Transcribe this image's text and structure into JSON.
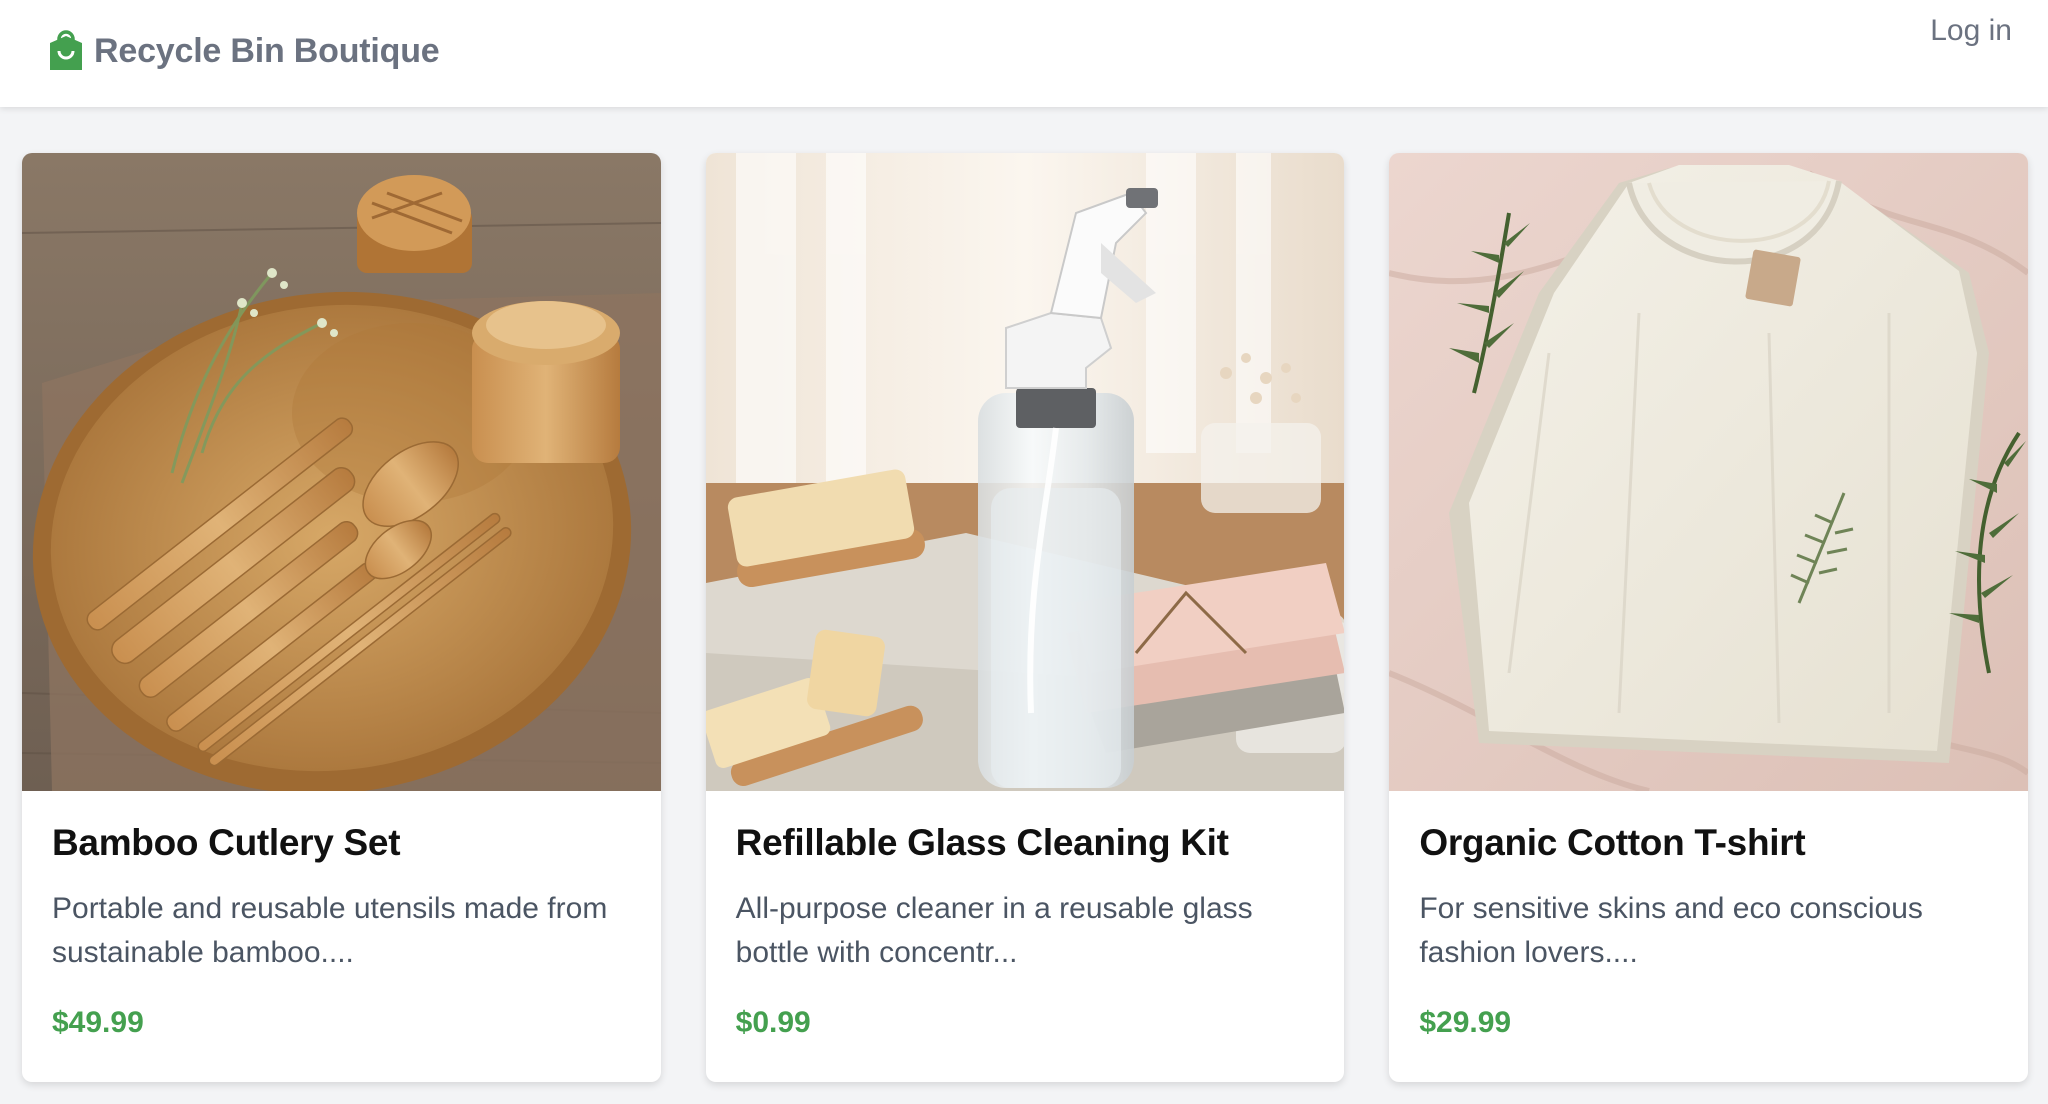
{
  "header": {
    "brand_name": "Recycle Bin Boutique",
    "brand_icon": "shopping-bag-icon",
    "login_label": "Log in"
  },
  "colors": {
    "brand_icon": "#44a04f",
    "price": "#44a04f",
    "text_muted": "#6b7280",
    "background": "#f3f4f6"
  },
  "products": [
    {
      "title": "Bamboo Cutlery Set",
      "description": "Portable and reusable utensils made from sustainable bamboo....",
      "price": "$49.99",
      "image": "bamboo-cutlery-photo"
    },
    {
      "title": "Refillable Glass Cleaning Kit",
      "description": "All-purpose cleaner in a reusable glass bottle with concentr...",
      "price": "$0.99",
      "image": "glass-cleaning-kit-photo"
    },
    {
      "title": "Organic Cotton T-shirt",
      "description": "For sensitive skins and eco conscious fashion lovers....",
      "price": "$29.99",
      "image": "cotton-tshirt-photo"
    }
  ]
}
